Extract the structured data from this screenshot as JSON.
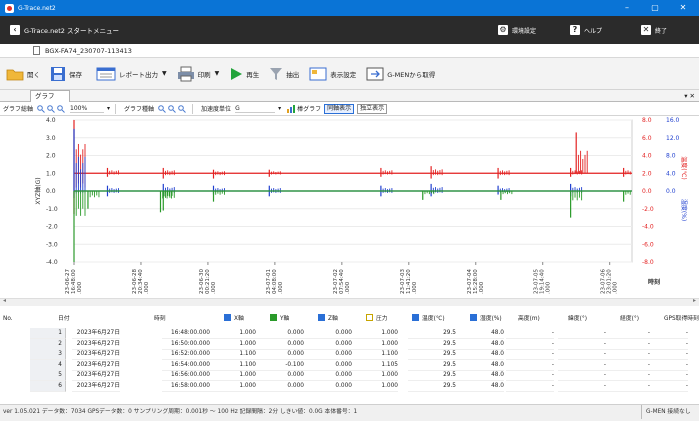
{
  "window": {
    "title": "G-Trace.net2",
    "minimize": "–",
    "maximize": "▢",
    "close": "✕"
  },
  "menubar": {
    "breadcrumb": "G-Trace.net2 スタートメニュー",
    "settings": "環境設定",
    "help": "ヘルプ",
    "exit": "終了"
  },
  "file_tab": {
    "name": "BGX-FA74_230707-113413"
  },
  "toolbar": {
    "open": "開く",
    "save": "保存",
    "report": "レポート出力",
    "print": "印刷",
    "play": "再生",
    "extract": "抽出",
    "display_settings": "表示設定",
    "gmen": "G-MENから取得"
  },
  "tabs": {
    "graph": "グラフ",
    "pin": "▾ ✕"
  },
  "graph_toolbar": {
    "all_axis": "グラフ総軸",
    "zoom": "100%",
    "graph_axis": "グラフ種軸",
    "accel_unit_label": "加速度単位",
    "accel_unit": "G",
    "bar_graph": "棒グラフ",
    "sync_display": "同軸表示",
    "separate_display": "独立表示"
  },
  "chart_data": {
    "type": "line",
    "y_left": {
      "label": "XYZ軸(G)",
      "ticks": [
        "4.0",
        "3.0",
        "2.0",
        "1.0",
        "0.0",
        "-1.0",
        "-2.0",
        "-3.0",
        "-4.0"
      ],
      "ylim": [
        -4,
        4
      ]
    },
    "y_right_temp": {
      "label": "温度(℃)",
      "ticks": [
        "8.0",
        "6.0",
        "4.0",
        "2.0",
        "0.0",
        "-2.0",
        "-4.0",
        "-6.0",
        "-8.0"
      ]
    },
    "y_right_hum": {
      "label": "湿度(%)",
      "ticks": [
        "16.0",
        "12.0",
        "8.0",
        "4.0",
        "0.0"
      ]
    },
    "x_label": "時刻",
    "x_ticks": [
      {
        "date": "23-06-27",
        "time": "16:48:00",
        "ms": ".000"
      },
      {
        "date": "23-06-28",
        "time": "20:34:40",
        "ms": ".000"
      },
      {
        "date": "23-06-30",
        "time": "00:21:20",
        "ms": ".000"
      },
      {
        "date": "23-07-01",
        "time": "04:08:00",
        "ms": ".000"
      },
      {
        "date": "23-07-02",
        "time": "07:54:40",
        "ms": ".000"
      },
      {
        "date": "23-07-03",
        "time": "11:41:20",
        "ms": ".000"
      },
      {
        "date": "23-07-04",
        "time": "15:28:00",
        "ms": ".000"
      },
      {
        "date": "23-07-05",
        "time": "19:14:40",
        "ms": ".000"
      },
      {
        "date": "23-07-06",
        "time": "23:01:20",
        "ms": ".000"
      }
    ],
    "series": [
      {
        "name": "X軸",
        "color": "#e32121",
        "baseline": 1.0,
        "spikes": [
          [
            0.0,
            4.0,
            -1.3
          ],
          [
            0.06,
            1.3,
            0.8
          ],
          [
            0.16,
            1.3,
            0.7
          ],
          [
            0.25,
            1.2,
            0.7
          ],
          [
            0.35,
            1.2,
            0.8
          ],
          [
            0.55,
            1.3,
            0.8
          ],
          [
            0.64,
            1.4,
            0.7
          ],
          [
            0.76,
            1.3,
            0.7
          ],
          [
            0.89,
            1.3,
            0.8
          ],
          [
            0.9,
            3.3,
            1.0
          ],
          [
            0.985,
            1.3,
            0.8
          ]
        ]
      },
      {
        "name": "Y軸",
        "color": "#1f3fcf",
        "baseline": 0.0,
        "spikes": [
          [
            0.0,
            3.5,
            -0.4
          ],
          [
            0.06,
            0.3,
            -0.3
          ],
          [
            0.16,
            0.4,
            -0.3
          ],
          [
            0.25,
            0.3,
            -0.2
          ],
          [
            0.35,
            0.3,
            -0.3
          ],
          [
            0.55,
            0.3,
            -0.3
          ],
          [
            0.64,
            0.4,
            -0.3
          ],
          [
            0.76,
            0.3,
            -0.2
          ],
          [
            0.89,
            0.4,
            -0.3
          ]
        ]
      },
      {
        "name": "Z軸",
        "color": "#2a9a2a",
        "baseline": 0.0,
        "spikes": [
          [
            0.0,
            0.0,
            -4.0
          ],
          [
            0.025,
            0.0,
            -1.0
          ],
          [
            0.155,
            0.0,
            -1.2
          ],
          [
            0.16,
            0.0,
            -1.1
          ],
          [
            0.25,
            0.0,
            -0.6
          ],
          [
            0.625,
            0.0,
            -0.5
          ],
          [
            0.765,
            0.0,
            -0.5
          ],
          [
            0.89,
            0.0,
            -1.5
          ],
          [
            0.985,
            0.0,
            -0.6
          ]
        ]
      }
    ]
  },
  "table": {
    "headers": [
      "No.",
      "日付",
      "時刻",
      "X軸",
      "Y軸",
      "Z軸",
      "圧力",
      "温度(℃)",
      "湿度(%)",
      "高度(m)",
      "緯度(°)",
      "経度(°)",
      "GPS取得時刻",
      "備考"
    ],
    "rows": [
      [
        "1",
        "2023年6月27日",
        "16:48:00.000",
        "1.000",
        "0.000",
        "0.000",
        "1.000",
        "29.5",
        "48.0",
        "-",
        "-",
        "-",
        "-",
        ""
      ],
      [
        "2",
        "2023年6月27日",
        "16:50:00.000",
        "1.000",
        "0.000",
        "0.000",
        "1.000",
        "29.5",
        "48.0",
        "-",
        "-",
        "-",
        "-",
        ""
      ],
      [
        "3",
        "2023年6月27日",
        "16:52:00.000",
        "1.100",
        "0.000",
        "0.000",
        "1.100",
        "29.5",
        "48.0",
        "-",
        "-",
        "-",
        "-",
        ""
      ],
      [
        "4",
        "2023年6月27日",
        "16:54:00.000",
        "1.100",
        "-0.100",
        "0.000",
        "1.105",
        "29.5",
        "48.0",
        "-",
        "-",
        "-",
        "-",
        ""
      ],
      [
        "5",
        "2023年6月27日",
        "16:56:00.000",
        "1.000",
        "0.000",
        "0.000",
        "1.000",
        "29.5",
        "48.0",
        "-",
        "-",
        "-",
        "-",
        ""
      ],
      [
        "6",
        "2023年6月27日",
        "16:58:00.000",
        "1.000",
        "0.000",
        "0.000",
        "1.000",
        "29.5",
        "48.0",
        "-",
        "-",
        "-",
        "-",
        ""
      ]
    ]
  },
  "status": {
    "text": "ver 1.05.021  データ数：7034  GPSデータ数：0  サンプリング周期：0.001秒 ～ 100 Hz  記録間隔：2分  しきい値：0.0G  本体番号：1",
    "right": "G-MEN 接続なし"
  },
  "colors": {
    "titlebar": "#0a74d6",
    "menubar": "#2b2b2b",
    "x_axis": "#e32121",
    "y_axis": "#1f3fcf",
    "z_axis": "#2a9a2a",
    "temp_axis": "#e32121",
    "hum_axis": "#1f3fcf"
  }
}
